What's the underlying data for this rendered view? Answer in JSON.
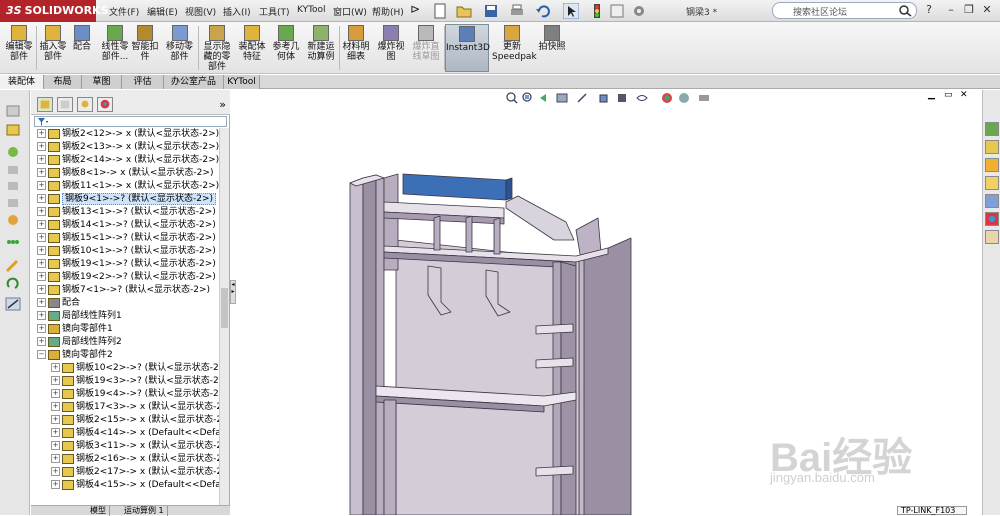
{
  "app": {
    "logo_mark": "3S",
    "logo_text": "SOLIDWORKS",
    "doc_title": "钢梁3 *"
  },
  "menu": [
    "文件(F)",
    "编辑(E)",
    "视图(V)",
    "插入(I)",
    "工具(T)",
    "KYTool",
    "窗口(W)",
    "帮助(H)"
  ],
  "search": {
    "placeholder": "搜索社区论坛"
  },
  "window_controls": {
    "minimize": "–",
    "restore": "❐",
    "close": "✕"
  },
  "commands": [
    {
      "label": "编辑零\n部件",
      "icon": "edit-component-icon"
    },
    {
      "label": "插入零\n部件",
      "icon": "insert-component-icon"
    },
    {
      "label": "配合",
      "icon": "mate-icon"
    },
    {
      "label": "线性零\n部件...",
      "icon": "linear-pattern-icon"
    },
    {
      "label": "智能扣\n件",
      "icon": "smart-fasteners-icon"
    },
    {
      "label": "移动零\n部件",
      "icon": "move-component-icon"
    },
    {
      "label": "显示隐\n藏的零\n部件",
      "icon": "show-hidden-icon"
    },
    {
      "label": "装配体\n特征",
      "icon": "assembly-features-icon"
    },
    {
      "label": "参考几\n何体",
      "icon": "reference-geometry-icon"
    },
    {
      "label": "新建运\n动算例",
      "icon": "new-motion-study-icon"
    },
    {
      "label": "材料明\n细表",
      "icon": "bom-icon"
    },
    {
      "label": "爆炸视\n图",
      "icon": "exploded-view-icon"
    },
    {
      "label": "爆炸直\n线草图",
      "icon": "explode-line-sketch-icon"
    },
    {
      "label": "Instant3D",
      "icon": "instant3d-icon"
    },
    {
      "label": "更新\nSpeedpak",
      "icon": "speedpak-icon"
    },
    {
      "label": "拍快照",
      "icon": "snapshot-icon"
    }
  ],
  "tabs": [
    "装配体",
    "布局",
    "草图",
    "评估",
    "办公室产品",
    "KYTool"
  ],
  "tree": [
    {
      "label": "钢板2<12>-> x (默认<显示状态-2>)",
      "indent": 0,
      "type": "part"
    },
    {
      "label": "钢板2<13>-> x (默认<显示状态-2>)",
      "indent": 0,
      "type": "part"
    },
    {
      "label": "钢板2<14>-> x (默认<显示状态-2>)",
      "indent": 0,
      "type": "part"
    },
    {
      "label": "钢板8<1>-> x (默认<显示状态-2>)",
      "indent": 0,
      "type": "part"
    },
    {
      "label": "钢板11<1>-> x (默认<显示状态-2>)",
      "indent": 0,
      "type": "part"
    },
    {
      "label": "钢板9<1>->? (默认<显示状态-2>)",
      "indent": 0,
      "type": "part",
      "selected": true
    },
    {
      "label": "钢板13<1>->? (默认<显示状态-2>)",
      "indent": 0,
      "type": "part"
    },
    {
      "label": "钢板14<1>->? (默认<显示状态-2>)",
      "indent": 0,
      "type": "part"
    },
    {
      "label": "钢板15<1>->? (默认<显示状态-2>)",
      "indent": 0,
      "type": "part"
    },
    {
      "label": "钢板10<1>->? (默认<显示状态-2>)",
      "indent": 0,
      "type": "part"
    },
    {
      "label": "钢板19<1>->? (默认<显示状态-2>)",
      "indent": 0,
      "type": "part"
    },
    {
      "label": "钢板19<2>->? (默认<显示状态-2>)",
      "indent": 0,
      "type": "part"
    },
    {
      "label": "钢板7<1>->? (默认<显示状态-2>)",
      "indent": 0,
      "type": "part"
    },
    {
      "label": "配合",
      "indent": 0,
      "type": "mates"
    },
    {
      "label": "局部线性阵列1",
      "indent": 0,
      "type": "pattern"
    },
    {
      "label": "镜向零部件1",
      "indent": 0,
      "type": "mirror"
    },
    {
      "label": "局部线性阵列2",
      "indent": 0,
      "type": "pattern"
    },
    {
      "label": "镜向零部件2",
      "indent": 0,
      "type": "mirror",
      "expanded": true
    },
    {
      "label": "钢板10<2>->? (默认<显示状态-2>",
      "indent": 1,
      "type": "part"
    },
    {
      "label": "钢板19<3>->? (默认<显示状态-2>",
      "indent": 1,
      "type": "part"
    },
    {
      "label": "钢板19<4>->? (默认<显示状态-2>",
      "indent": 1,
      "type": "part"
    },
    {
      "label": "钢板17<3>-> x (默认<显示状态-2:",
      "indent": 1,
      "type": "part"
    },
    {
      "label": "钢板2<15>-> x (默认<显示状态-2:",
      "indent": 1,
      "type": "part"
    },
    {
      "label": "钢板4<14>-> x (Default<<Defaul",
      "indent": 1,
      "type": "part"
    },
    {
      "label": "钢板3<11>-> x (默认<显示状态-2:",
      "indent": 1,
      "type": "part"
    },
    {
      "label": "钢板2<16>-> x (默认<显示状态-2:",
      "indent": 1,
      "type": "part"
    },
    {
      "label": "钢板2<17>-> x (默认<显示状态-2:",
      "indent": 1,
      "type": "part"
    },
    {
      "label": "钢板4<15>-> x (Default<<Defaul",
      "indent": 1,
      "type": "part"
    }
  ],
  "bottom_tabs": [
    "模型",
    "运动算例 1"
  ],
  "status_tip": "TP-LINK_F103",
  "watermark": {
    "brand": "Bai经验",
    "url": "jingyan.baidu.com"
  },
  "colors": {
    "logo_bg": "#b2242a",
    "selected_part": "#3d6fb6",
    "steel": "#c9c0cf",
    "steel_dark": "#8d8296"
  }
}
